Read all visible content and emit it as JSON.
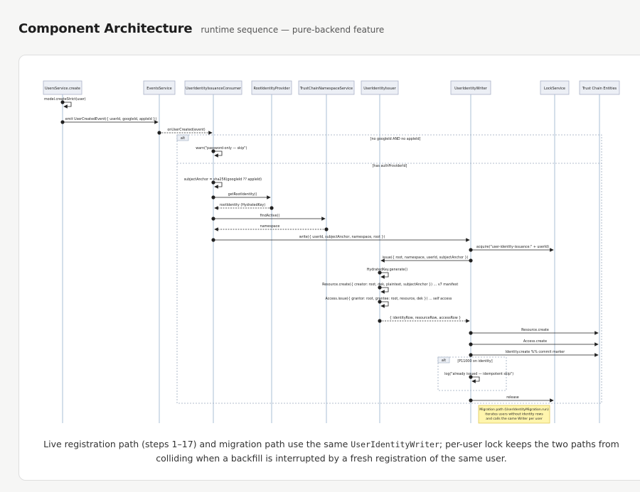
{
  "header": {
    "title": "Component Architecture",
    "subtitle": "runtime sequence — pure-backend feature"
  },
  "participants": [
    "UsersService.create",
    "EventsService",
    "UserIdentityIssuanceConsumer",
    "RootIdentityProvider",
    "TrustChainNamespaceService",
    "UserIdentityIssuer",
    "UserIdentityWriter",
    "LockService",
    "Trust Chain Entities"
  ],
  "fragments": [
    {
      "id": "alt-main",
      "tag": "alt",
      "branches": [
        "[no googleId AND no appleId]",
        "[has authProviderId]"
      ]
    },
    {
      "id": "alt-inner",
      "tag": "alt",
      "branches": [
        "[P11000 on identity]"
      ]
    }
  ],
  "messages": [
    {
      "from": 0,
      "to": 0,
      "label": "model.createStrict(user)",
      "kind": "self"
    },
    {
      "from": 0,
      "to": 1,
      "label": "emit UserCreatedEvent({ userId, googleId, appleId })",
      "kind": "sync"
    },
    {
      "from": 1,
      "to": 2,
      "label": "onUserCreated(event)",
      "kind": "async"
    },
    {
      "from": 2,
      "to": 2,
      "label": "warn(\"password-only — skip\")",
      "kind": "self"
    },
    {
      "from": 2,
      "to": 2,
      "label": "subjectAnchor = sha256(googleId ?? appleId)",
      "kind": "self"
    },
    {
      "from": 2,
      "to": 3,
      "label": "getRootIdentity()",
      "kind": "sync"
    },
    {
      "from": 3,
      "to": 2,
      "label": "rootIdentity (HydratedKey)",
      "kind": "reply"
    },
    {
      "from": 2,
      "to": 4,
      "label": "findActive()",
      "kind": "sync"
    },
    {
      "from": 4,
      "to": 2,
      "label": "namespace",
      "kind": "reply"
    },
    {
      "from": 2,
      "to": 6,
      "label": "write({ userId, subjectAnchor, namespace, root })",
      "kind": "sync"
    },
    {
      "from": 6,
      "to": 7,
      "label": "acquire(\"user-identity-issuance:\" + userId)",
      "kind": "sync"
    },
    {
      "from": 6,
      "to": 5,
      "label": "issue({ root, namespace, userId, subjectAnchor })",
      "kind": "sync"
    },
    {
      "from": 5,
      "to": 5,
      "label": "HydratedKey.generate()",
      "kind": "self"
    },
    {
      "from": 5,
      "to": 5,
      "label": "Resource.create({ creator: root, dek, plaintext, subjectAnchor }) … v7 manifest",
      "kind": "self"
    },
    {
      "from": 5,
      "to": 5,
      "label": "Access.issue({ grantor: root, grantee: root, resource, dek }) … self access",
      "kind": "self"
    },
    {
      "from": 5,
      "to": 6,
      "label": "{ identityRow, resourceRow, accessRow }",
      "kind": "reply"
    },
    {
      "from": 6,
      "to": 8,
      "label": "Resource.create",
      "kind": "sync"
    },
    {
      "from": 6,
      "to": 8,
      "label": "Access.create",
      "kind": "sync"
    },
    {
      "from": 6,
      "to": 8,
      "label": "Identity.create %% commit marker",
      "kind": "sync"
    },
    {
      "from": 6,
      "to": 6,
      "label": "log(\"already issued — idempotent skip\")",
      "kind": "self"
    },
    {
      "from": 6,
      "to": 7,
      "label": "release",
      "kind": "sync"
    }
  ],
  "note": {
    "lines": [
      "Migration path (UserIdentityMigration.run)",
      "iterates users without identity rows",
      "and calls the same Writer per user"
    ]
  },
  "caption": {
    "before": "Live registration path (steps 1–17) and migration path use the same ",
    "code": "UserIdentityWriter",
    "after": "; per-user lock keeps the two paths from colliding when a backfill is interrupted by a fresh registration of the same user."
  },
  "colors": {
    "participant_fill": "#eceff5",
    "participant_stroke": "#aab2c8",
    "lifeline": "#a9bfd6",
    "note_fill": "#fff5ad",
    "note_stroke": "#e0c95a"
  }
}
